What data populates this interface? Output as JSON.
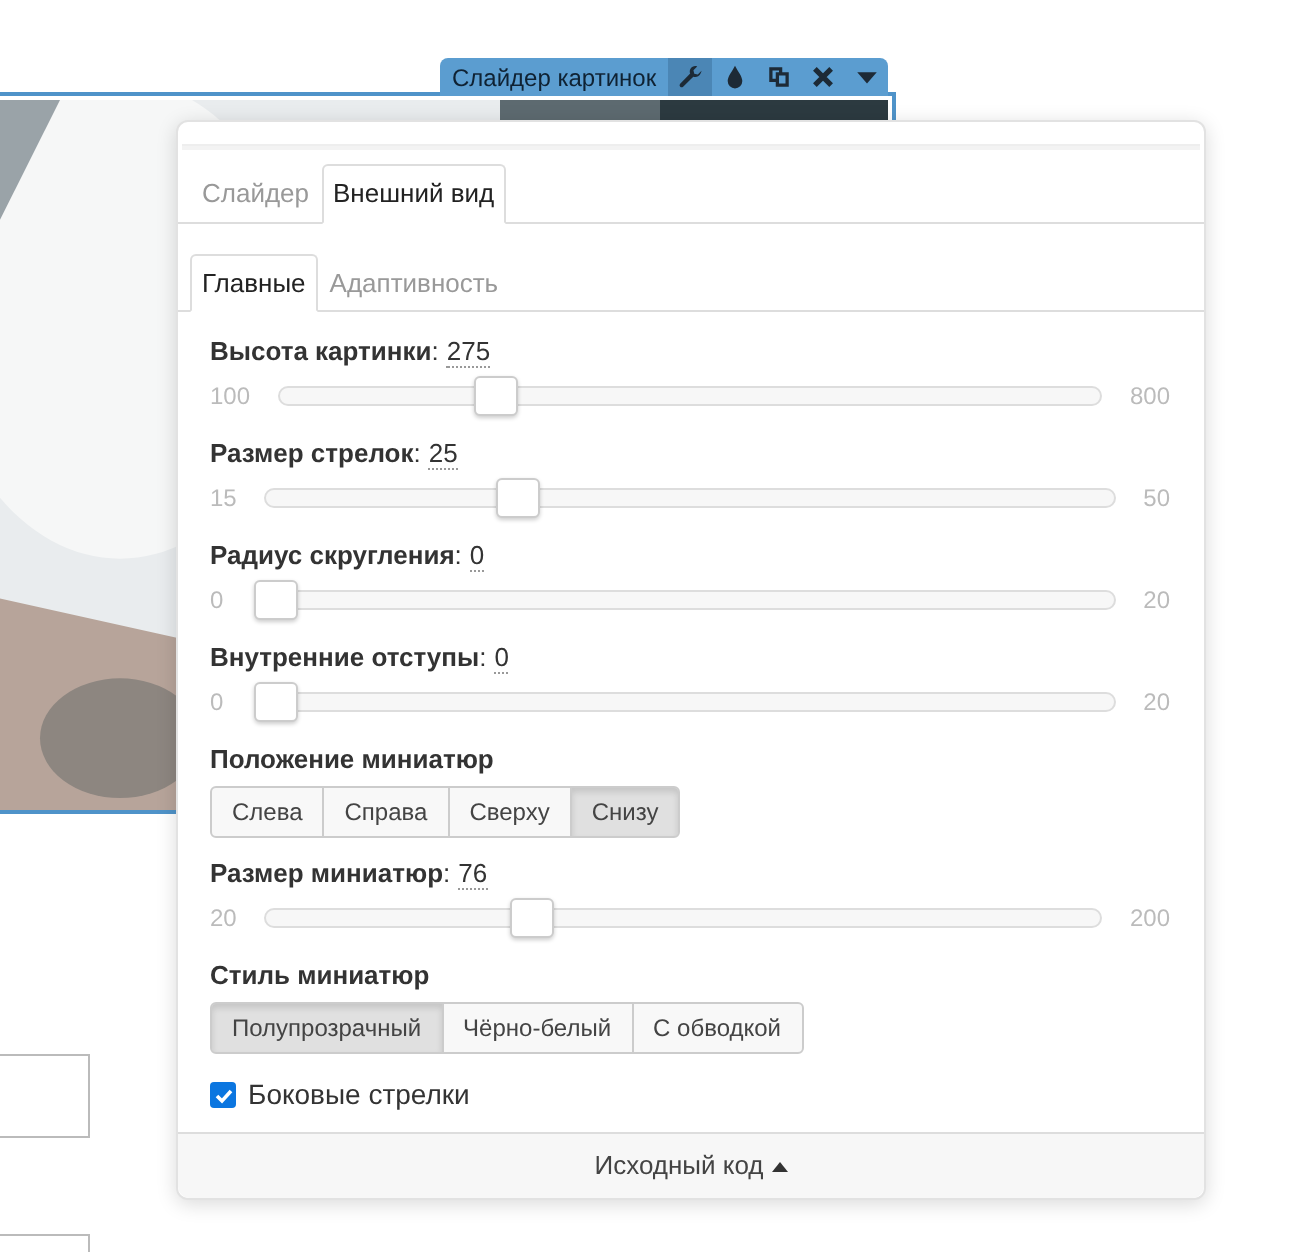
{
  "toolbar": {
    "title": "Слайдер картинок",
    "buttons": [
      {
        "kind": "wrench",
        "selected": true
      },
      {
        "kind": "drop",
        "selected": false
      },
      {
        "kind": "copy",
        "selected": false
      },
      {
        "kind": "close",
        "selected": false
      },
      {
        "kind": "caret",
        "selected": false
      }
    ]
  },
  "tabs": [
    {
      "label": "Слайдер",
      "selected": false
    },
    {
      "label": "Внешний вид",
      "selected": true
    }
  ],
  "subtabs": [
    {
      "label": "Главные",
      "selected": true
    },
    {
      "label": "Адаптивность",
      "selected": false
    }
  ],
  "settings": [
    {
      "kind": "slider",
      "label": "**Высота картинки**:",
      "value": "275",
      "min": "100",
      "max": "800",
      "level": 0.25
    },
    {
      "kind": "slider",
      "label": "**Размер стрелок**:",
      "value": "25",
      "min": "15",
      "max": "50",
      "level": 0.286
    },
    {
      "kind": "slider",
      "label": "**Радиус скругления**:",
      "value": "0",
      "min": "0",
      "max": "20",
      "level": 0
    },
    {
      "kind": "slider",
      "label": "**Внутренние отступы**:",
      "value": "0",
      "min": "0",
      "max": "20",
      "level": 0
    },
    {
      "kind": "segmented",
      "label": "Положение миниатюр",
      "options": [
        {
          "label": "Слева",
          "selected": false
        },
        {
          "label": "Справа",
          "selected": false
        },
        {
          "label": "Сверху",
          "selected": false
        },
        {
          "label": "Снизу",
          "selected": true
        }
      ]
    },
    {
      "kind": "slider",
      "label": "**Размер миниатюр**:",
      "value": "76",
      "min": "20",
      "max": "200",
      "level": 0.31
    },
    {
      "kind": "segmented",
      "label": "Стиль миниатюр",
      "options": [
        {
          "label": "Полупрозрачный",
          "selected": true
        },
        {
          "label": "Чёрно-белый",
          "selected": false
        },
        {
          "label": "С обводкой",
          "selected": false
        }
      ]
    },
    {
      "kind": "checkbox",
      "label": "Боковые стрелки",
      "checked": true
    }
  ],
  "footer": {
    "label": "Исходный код"
  }
}
